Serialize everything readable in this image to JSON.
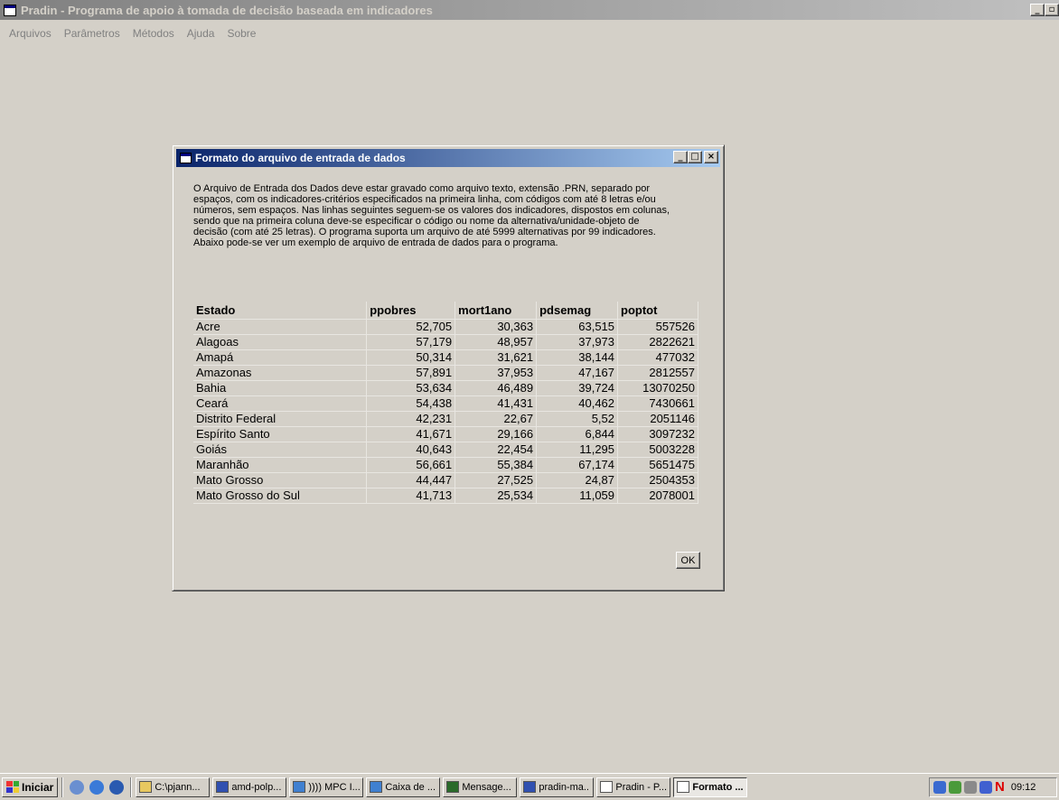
{
  "main_window": {
    "title": "Pradin - Programa de apoio à tomada de decisão baseada em indicadores",
    "buttons": {
      "minimize": "_",
      "maximize": "▫",
      "close": "×"
    }
  },
  "menu": [
    "Arquivos",
    "Parâmetros",
    "Métodos",
    "Ajuda",
    "Sobre"
  ],
  "dialog": {
    "title": "Formato do arquivo de entrada de dados",
    "buttons": {
      "minimize": "_",
      "maximize": "□",
      "close": "×"
    },
    "description": [
      "O Arquivo de Entrada dos Dados deve estar gravado como arquivo texto, extensão .PRN, separado por",
      "espaços, com os indicadores-critérios especificados na primeira linha, com códigos com até 8  letras e/ou",
      "números, sem espaços. Nas linhas seguintes seguem-se os valores dos indicadores, dispostos em colunas,",
      "sendo que na primeira coluna deve-se especificar o código ou nome da alternativa/unidade-objeto de",
      "decisão (com até 25 letras). O programa suporta um arquivo de até 5999 alternativas por 99 indicadores.",
      "Abaixo pode-se ver um exemplo de arquivo de entrada de dados para o programa."
    ],
    "table": {
      "headers": [
        "Estado",
        "ppobres",
        "mort1ano",
        "pdsemag",
        "poptot"
      ],
      "rows": [
        [
          "Acre",
          "52,705",
          "30,363",
          "63,515",
          "557526"
        ],
        [
          "Alagoas",
          "57,179",
          "48,957",
          "37,973",
          "2822621"
        ],
        [
          "Amapá",
          "50,314",
          "31,621",
          "38,144",
          "477032"
        ],
        [
          "Amazonas",
          "57,891",
          "37,953",
          "47,167",
          "2812557"
        ],
        [
          "Bahia",
          "53,634",
          "46,489",
          "39,724",
          "13070250"
        ],
        [
          "Ceará",
          "54,438",
          "41,431",
          "40,462",
          "7430661"
        ],
        [
          "Distrito Federal",
          "42,231",
          "22,67",
          "5,52",
          "2051146"
        ],
        [
          "Espírito Santo",
          "41,671",
          "29,166",
          "6,844",
          "3097232"
        ],
        [
          "Goiás",
          "40,643",
          "22,454",
          "11,295",
          "5003228"
        ],
        [
          "Maranhão",
          "56,661",
          "55,384",
          "67,174",
          "5651475"
        ],
        [
          "Mato Grosso",
          "44,447",
          "27,525",
          "24,87",
          "2504353"
        ],
        [
          "Mato Grosso do Sul",
          "41,713",
          "25,534",
          "11,059",
          "2078001"
        ]
      ]
    },
    "ok_label": "OK"
  },
  "taskbar": {
    "start_label": "Iniciar",
    "tasks": [
      {
        "label": "C:\\pjann...",
        "color": "#e8c860"
      },
      {
        "label": "amd-polp...",
        "color": "#3050b0"
      },
      {
        "label": ")))) MPC I...",
        "color": "#4080d0"
      },
      {
        "label": "Caixa de ...",
        "color": "#4080d0"
      },
      {
        "label": "Mensage...",
        "color": "#2a6a2a"
      },
      {
        "label": "pradin-ma...",
        "color": "#3050b0"
      },
      {
        "label": "Pradin - P...",
        "color": "#ffffff"
      },
      {
        "label": "Formato ...",
        "color": "#ffffff"
      }
    ],
    "active_task": 7,
    "clock": "09:12"
  }
}
